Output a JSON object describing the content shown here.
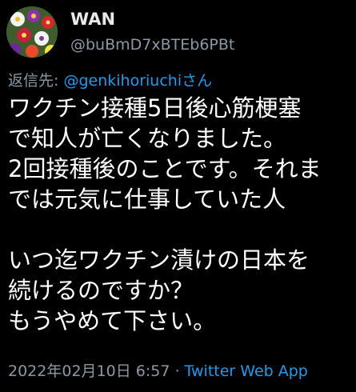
{
  "user": {
    "name": "WAN",
    "handle": "@buBmD7xBTEb6PBt"
  },
  "reply": {
    "prefix": "返信先: ",
    "mention": "@genkihoriuchi",
    "suffix": "さん"
  },
  "tweet": {
    "lines": [
      "ワクチン接種5日後心筋梗塞",
      "で知人が亡くなりました。",
      "2回接種後のことです。それま",
      "では元気に仕事していた人",
      "",
      "いつ迄ワクチン漬けの日本を",
      "続けるのですか？",
      "もうやめて下さい。"
    ]
  },
  "meta": {
    "timestamp": "2022年02月10日 6:57",
    "separator": " · ",
    "source": "Twitter Web App"
  },
  "colors": {
    "background": "#000000",
    "text": "#ffffff",
    "secondary": "#8b98a5",
    "link": "#1d9bf0"
  },
  "icons": {
    "avatar": "flower-photo-avatar"
  }
}
